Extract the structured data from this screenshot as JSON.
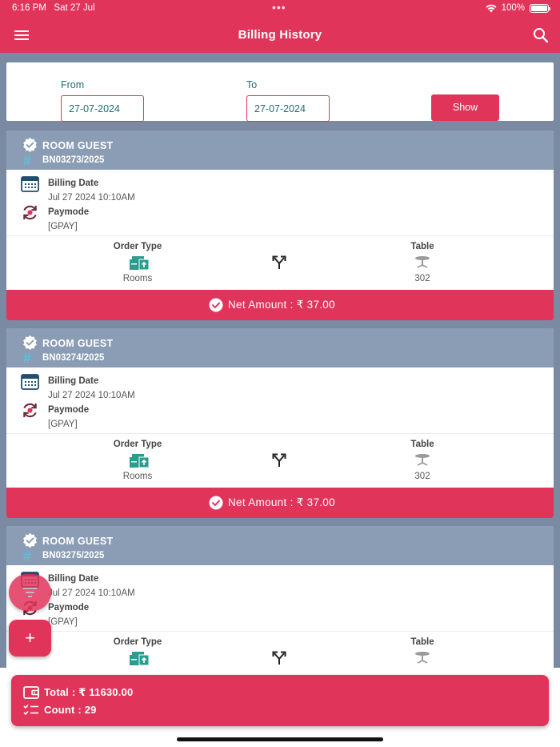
{
  "status_bar": {
    "time": "6:16 PM",
    "date": "Sat 27 Jul",
    "battery": "100%"
  },
  "appbar": {
    "title": "Billing History"
  },
  "filter": {
    "from_label": "From",
    "from_value": "27-07-2024",
    "to_label": "To",
    "to_value": "27-07-2024",
    "show_label": "Show"
  },
  "labels": {
    "billing_date": "Billing Date",
    "paymode": "Paymode",
    "order_type": "Order Type",
    "table": "Table"
  },
  "bills": [
    {
      "guest": "ROOM GUEST",
      "bill_no": "BN03273/2025",
      "billing_date": "Jul 27 2024 10:10AM",
      "paymode": "[GPAY]",
      "order_type": "Rooms",
      "table": "302",
      "net_amount": "Net Amount : ₹ 37.00"
    },
    {
      "guest": "ROOM GUEST",
      "bill_no": "BN03274/2025",
      "billing_date": "Jul 27 2024 10:10AM",
      "paymode": "[GPAY]",
      "order_type": "Rooms",
      "table": "302",
      "net_amount": "Net Amount : ₹ 37.00"
    },
    {
      "guest": "ROOM GUEST",
      "bill_no": "BN03275/2025",
      "billing_date": "Jul 27 2024 10:10AM",
      "paymode": "[GPAY]",
      "order_type": "",
      "table": "",
      "net_amount": ""
    }
  ],
  "footer": {
    "total": "Total : ₹ 11630.00",
    "count": "Count : 29"
  },
  "icons": {
    "menu": "hamburger-icon",
    "search": "search-icon",
    "verified": "verified-badge-icon",
    "hash": "hash-icon",
    "calendar": "calendar-icon",
    "paymode": "payment-cycle-icon",
    "order_type": "room-service-icon",
    "split": "split-arrows-icon",
    "table": "table-icon",
    "check": "check-circle-icon",
    "filter": "filter-icon",
    "add": "plus-icon",
    "wallet": "wallet-icon",
    "count": "checklist-icon"
  },
  "colors": {
    "primary": "#e0345a",
    "card_header": "#8b9db4",
    "background": "#7a8aa3",
    "order_icon": "#2a9d8f",
    "hash": "#5bc0de"
  }
}
